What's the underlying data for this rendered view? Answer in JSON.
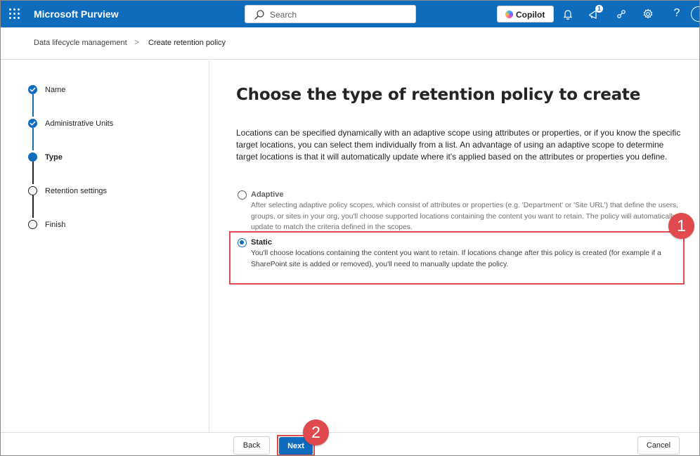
{
  "header": {
    "app_title": "Microsoft Purview",
    "search_placeholder": "Search",
    "copilot_label": "Copilot",
    "notification_count": "1",
    "help_label": "?"
  },
  "breadcrumb": {
    "items": [
      "Data lifecycle management",
      "Create retention policy"
    ],
    "separator": ">"
  },
  "stepper": {
    "steps": [
      {
        "label": "Name",
        "state": "done"
      },
      {
        "label": "Administrative Units",
        "state": "done"
      },
      {
        "label": "Type",
        "state": "current"
      },
      {
        "label": "Retention settings",
        "state": "todo"
      },
      {
        "label": "Finish",
        "state": "todo"
      }
    ]
  },
  "main": {
    "title": "Choose the type of retention policy to create",
    "description": "Locations can be specified dynamically with an adaptive scope using attributes or properties, or if you know the specific target locations, you can select them individually from a list. An advantage of using an adaptive scope to determine target locations is that it will automatically update where it's applied based on the attributes or properties you define.",
    "options": [
      {
        "title": "Adaptive",
        "description": "After selecting adaptive policy scopes, which consist of attributes or properties (e.g. 'Department' or 'Site URL') that define the users, groups, or sites in your org, you'll choose supported locations containing the content you want to retain. The policy will automatically update to match the criteria defined in the scopes.",
        "selected": false
      },
      {
        "title": "Static",
        "description": "You'll choose locations containing the content you want to retain. If locations change after this policy is created (for example if a SharePoint site is added or removed), you'll need to manually update the policy.",
        "selected": true
      }
    ]
  },
  "annotations": {
    "marker_1": "1",
    "marker_2": "2"
  },
  "footer": {
    "back_label": "Back",
    "next_label": "Next",
    "cancel_label": "Cancel"
  },
  "colors": {
    "brand": "#0f6cbd",
    "annotation": "#e04a4f"
  }
}
